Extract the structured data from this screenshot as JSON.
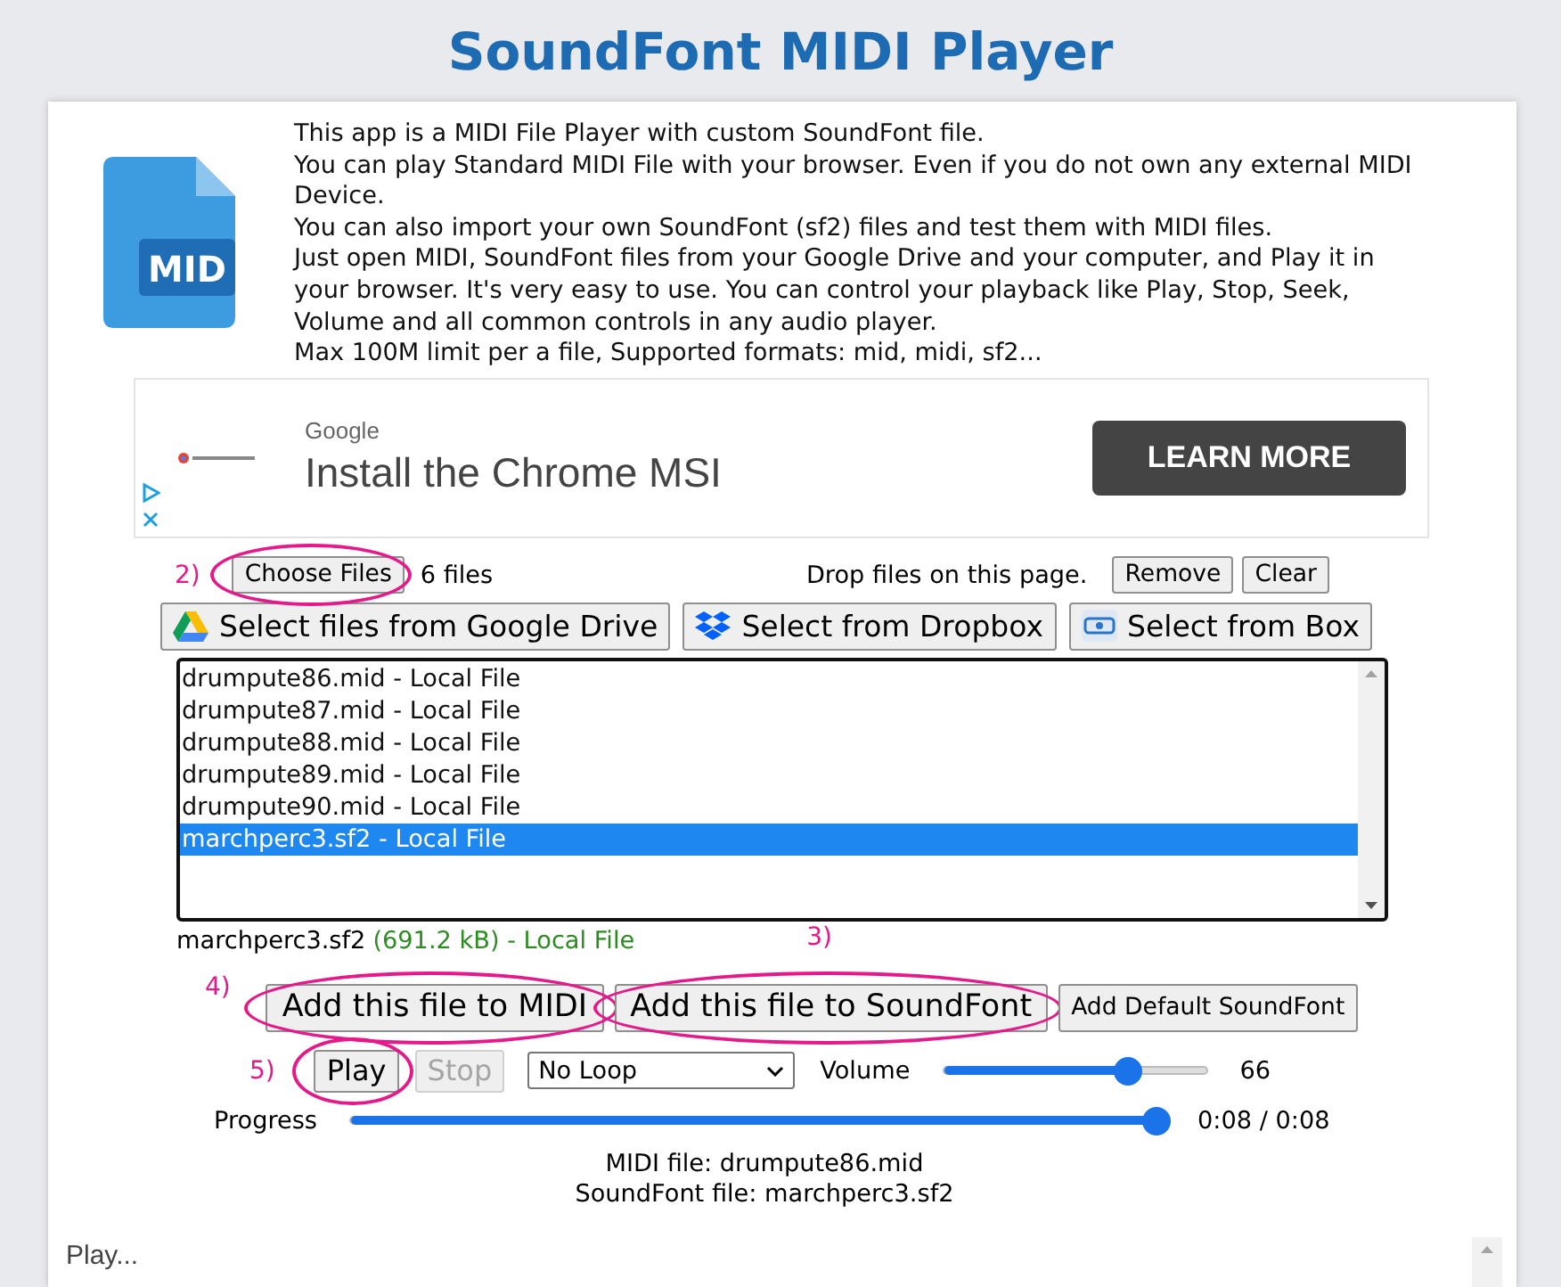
{
  "title": "SoundFont MIDI Player",
  "file_icon_label": "MID",
  "intro": [
    "This app is a MIDI File Player with custom SoundFont file.",
    "You can play Standard MIDI File with your browser. Even if you do not own any external MIDI Device.",
    "You can also import your own SoundFont (sf2) files and test them with MIDI files.",
    "Just open MIDI, SoundFont files from your Google Drive and your computer, and Play it in your browser. It's very easy to use. You can control your playback like Play, Stop, Seek, Volume and all common controls in any audio player.",
    "Max 100M limit per a file, Supported formats: mid, midi, sf2..."
  ],
  "ad": {
    "advertiser": "Google",
    "headline": "Install the Chrome MSI",
    "cta": "LEARN MORE"
  },
  "file_row": {
    "choose": {
      "label": "Choose Files",
      "circled": true,
      "callout": "2)"
    },
    "count": "6 files",
    "drop_hint": "Drop files on this page.",
    "buttons": [
      "Remove",
      "Clear"
    ]
  },
  "cloud_buttons": [
    {
      "label": "Select files from Google Drive",
      "kind": "gdrive"
    },
    {
      "label": "Select from Dropbox",
      "kind": "dropbox"
    },
    {
      "label": "Select from Box",
      "kind": "box"
    }
  ],
  "file_list": [
    {
      "name": "drumpute86.mid - Local File",
      "selected": false
    },
    {
      "name": "drumpute87.mid - Local File",
      "selected": false
    },
    {
      "name": "drumpute88.mid - Local File",
      "selected": false
    },
    {
      "name": "drumpute89.mid - Local File",
      "selected": false
    },
    {
      "name": "drumpute90.mid - Local File",
      "selected": false
    },
    {
      "name": "marchperc3.sf2 - Local File",
      "selected": true
    }
  ],
  "file_info": {
    "name": "marchperc3.sf2",
    "detail": "(691.2 kB) - Local File"
  },
  "add_buttons": [
    {
      "label": "Add this file to MIDI",
      "large": true,
      "circled": true,
      "callout": "4)"
    },
    {
      "label": "Add this file to SoundFont",
      "large": true,
      "circled": true,
      "callout": "3)"
    },
    {
      "label": "Add Default SoundFont",
      "large": false,
      "circled": false
    }
  ],
  "playback": {
    "play": {
      "label": "Play",
      "circled": true,
      "callout": "5)",
      "disabled": false
    },
    "stop": {
      "label": "Stop",
      "disabled": true
    },
    "loop": "No Loop",
    "volume_label": "Volume",
    "volume": {
      "level": 0.7
    },
    "volume_reading": "66",
    "progress_label": "Progress",
    "progress": {
      "level": 1
    },
    "time": "0:08 / 0:08"
  },
  "loaded": [
    "MIDI file: drumpute86.mid",
    "SoundFont file: marchperc3.sf2"
  ],
  "log": "Play..."
}
